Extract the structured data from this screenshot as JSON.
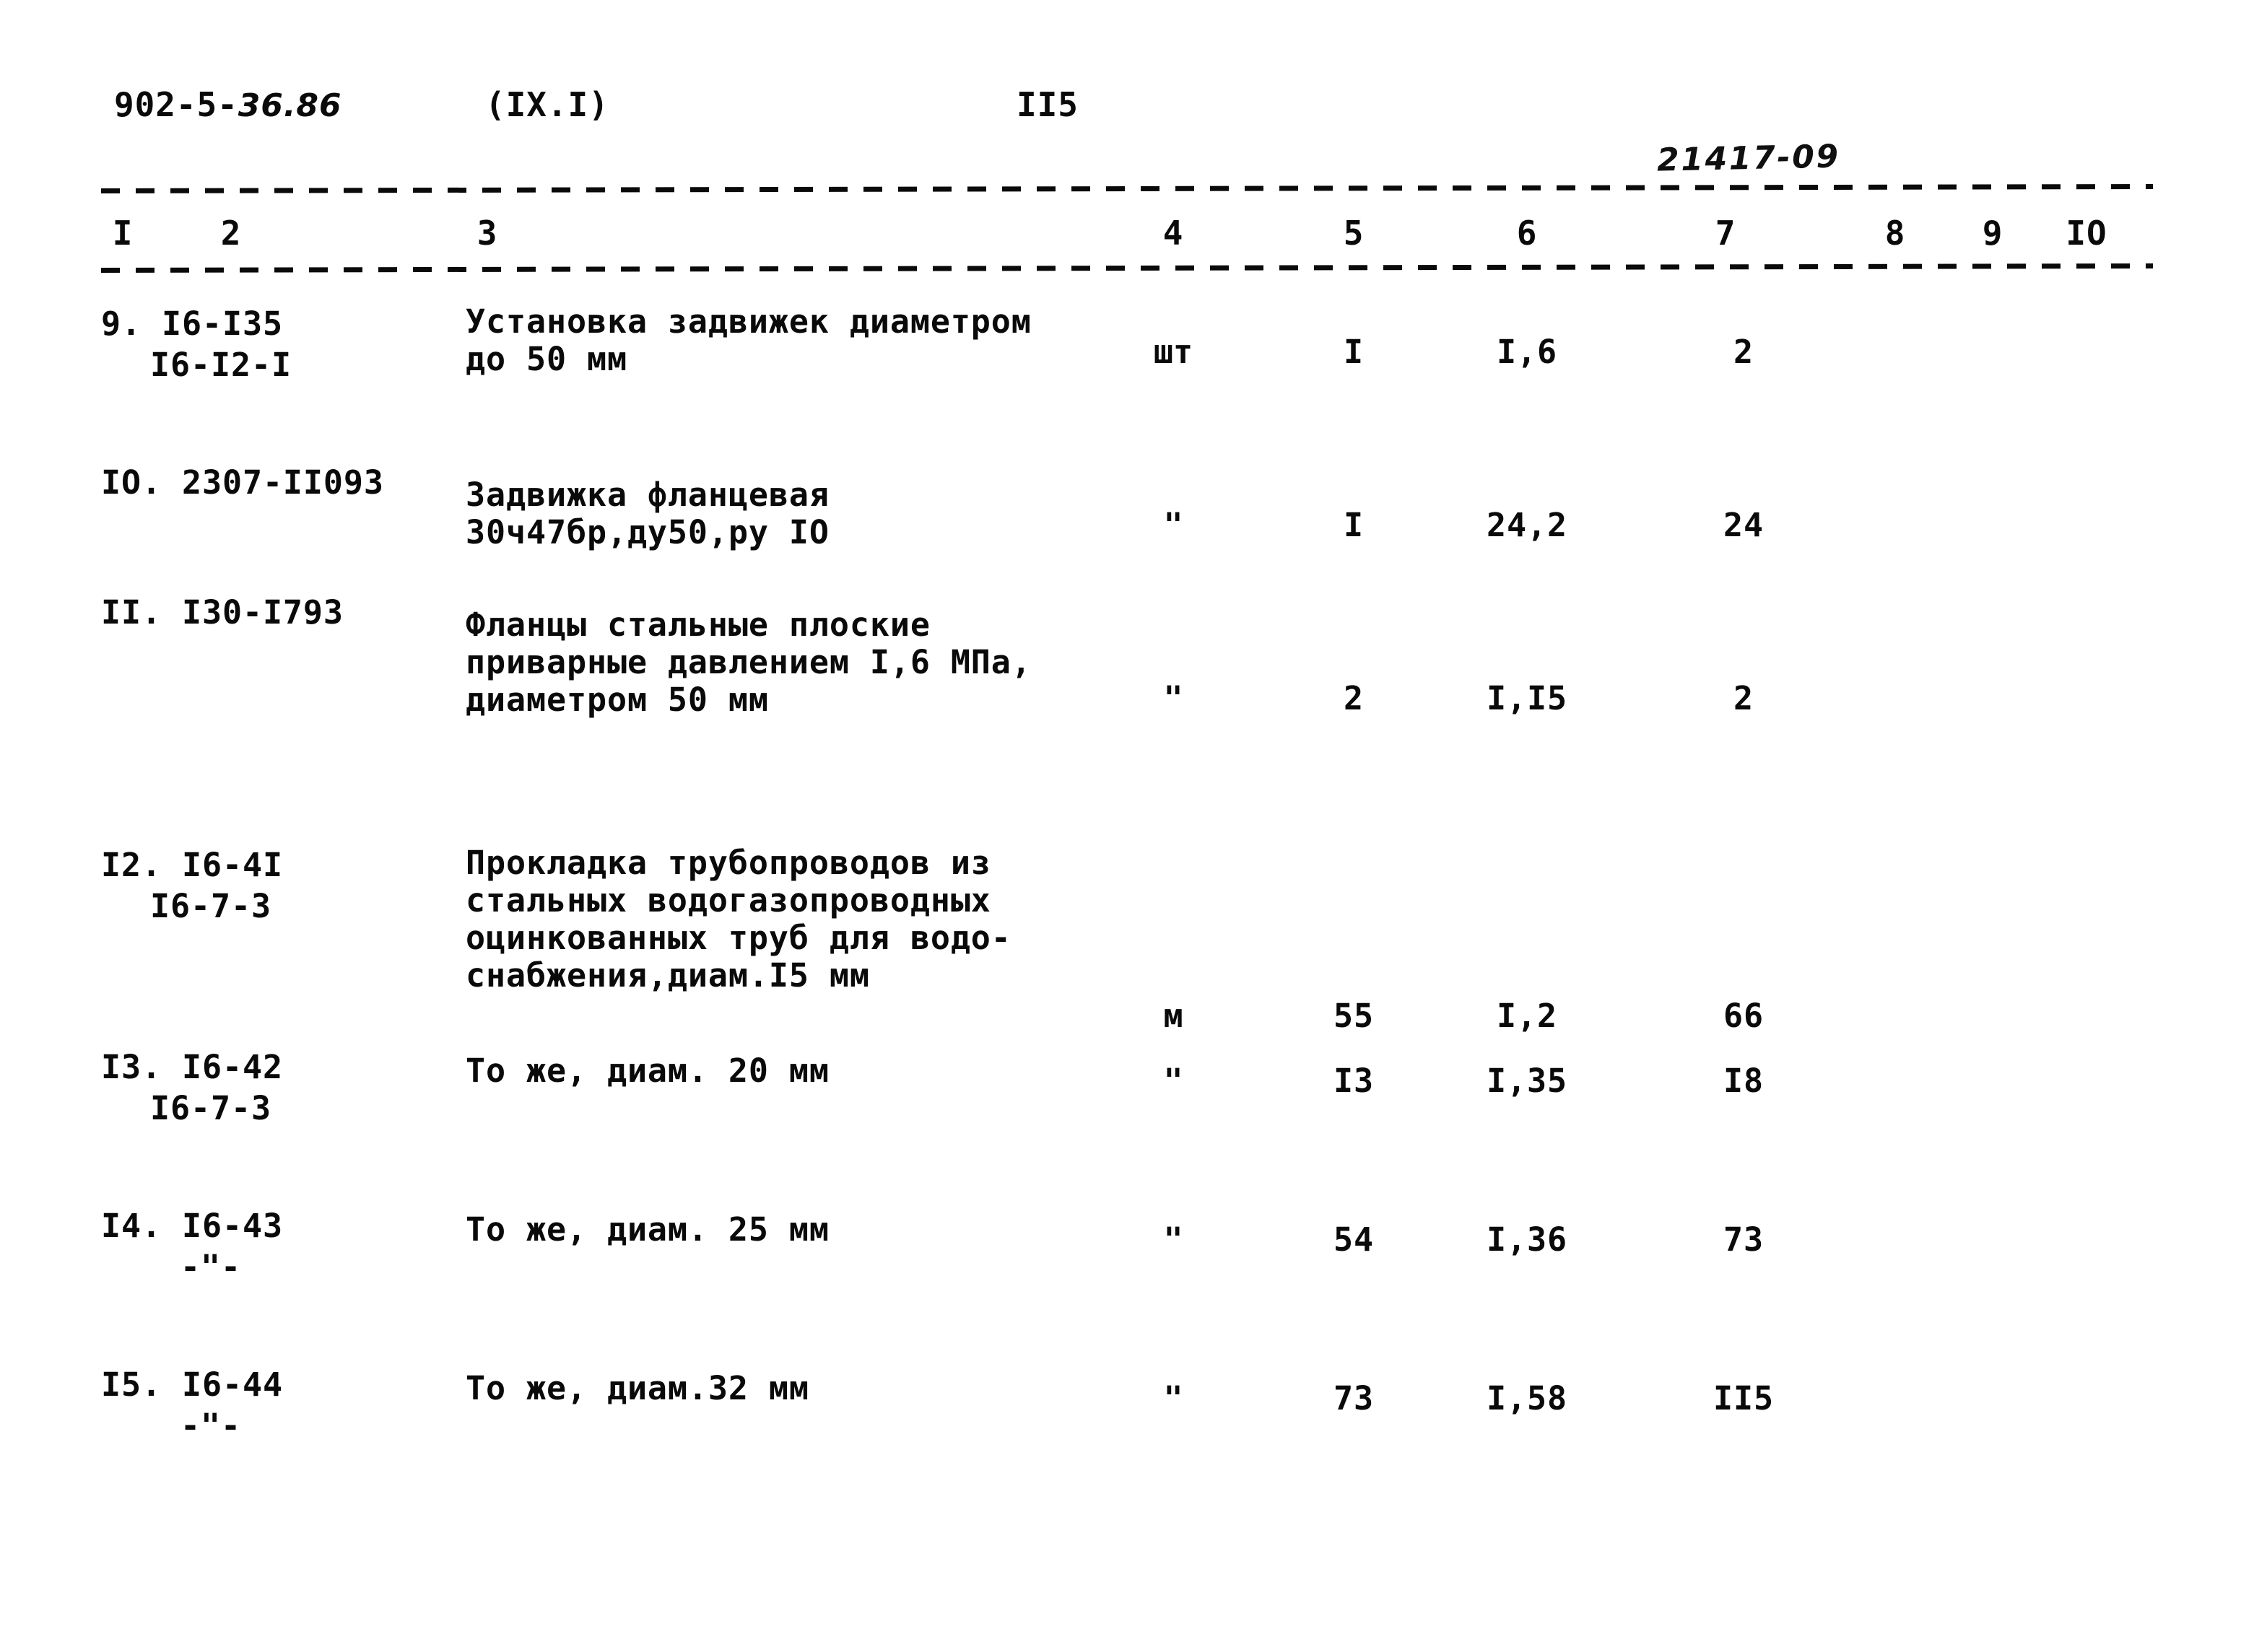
{
  "header": {
    "doc_code_prefix": "902-5-",
    "doc_code_suffix": "36.86",
    "section_code": "(IX.I)",
    "page_number": "II5",
    "handwritten_annotation": "21417-09"
  },
  "table": {
    "column_numbers": [
      "I",
      "2",
      "3",
      "4",
      "5",
      "6",
      "7",
      "8",
      "9",
      "IO"
    ],
    "rows": [
      {
        "index_line1": "9. I6-I35",
        "index_line2": "I6-I2-I",
        "index_ditto": "",
        "description": [
          "Установка задвижек диаметром",
          "до 50 мм"
        ],
        "unit": "шт",
        "quantity": "I",
        "norm": "I,6",
        "total": "2"
      },
      {
        "index_line1": "IO. 2307-II093",
        "index_line2": "",
        "index_ditto": "",
        "description": [
          "Задвижка фланцевая",
          "30ч47бр,ду50,ру IO"
        ],
        "unit": "\"",
        "quantity": "I",
        "norm": "24,2",
        "total": "24"
      },
      {
        "index_line1": "II. I30-I793",
        "index_line2": "",
        "index_ditto": "",
        "description": [
          "Фланцы стальные плоские",
          "приварные давлением I,6 МПа,",
          "диаметром 50 мм"
        ],
        "unit": "\"",
        "quantity": "2",
        "norm": "I,I5",
        "total": "2"
      },
      {
        "index_line1": "I2. I6-4I",
        "index_line2": "I6-7-3",
        "index_ditto": "",
        "description": [
          "Прокладка трубопроводов из",
          "стальных водогазопроводных",
          "оцинкованных труб для водо-",
          "снабжения,диам.I5 мм"
        ],
        "unit": "м",
        "quantity": "55",
        "norm": "I,2",
        "total": "66"
      },
      {
        "index_line1": "I3. I6-42",
        "index_line2": "I6-7-3",
        "index_ditto": "",
        "description": [
          "То же, диам. 20 мм"
        ],
        "unit": "\"",
        "quantity": "I3",
        "norm": "I,35",
        "total": "I8"
      },
      {
        "index_line1": "I4. I6-43",
        "index_line2": "",
        "index_ditto": "-\"-",
        "description": [
          "То же, диам. 25 мм"
        ],
        "unit": "\"",
        "quantity": "54",
        "norm": "I,36",
        "total": "73"
      },
      {
        "index_line1": "I5. I6-44",
        "index_line2": "",
        "index_ditto": "-\"-",
        "description": [
          "То же, диам.32 мм"
        ],
        "unit": "\"",
        "quantity": "73",
        "norm": "I,58",
        "total": "II5"
      }
    ]
  }
}
